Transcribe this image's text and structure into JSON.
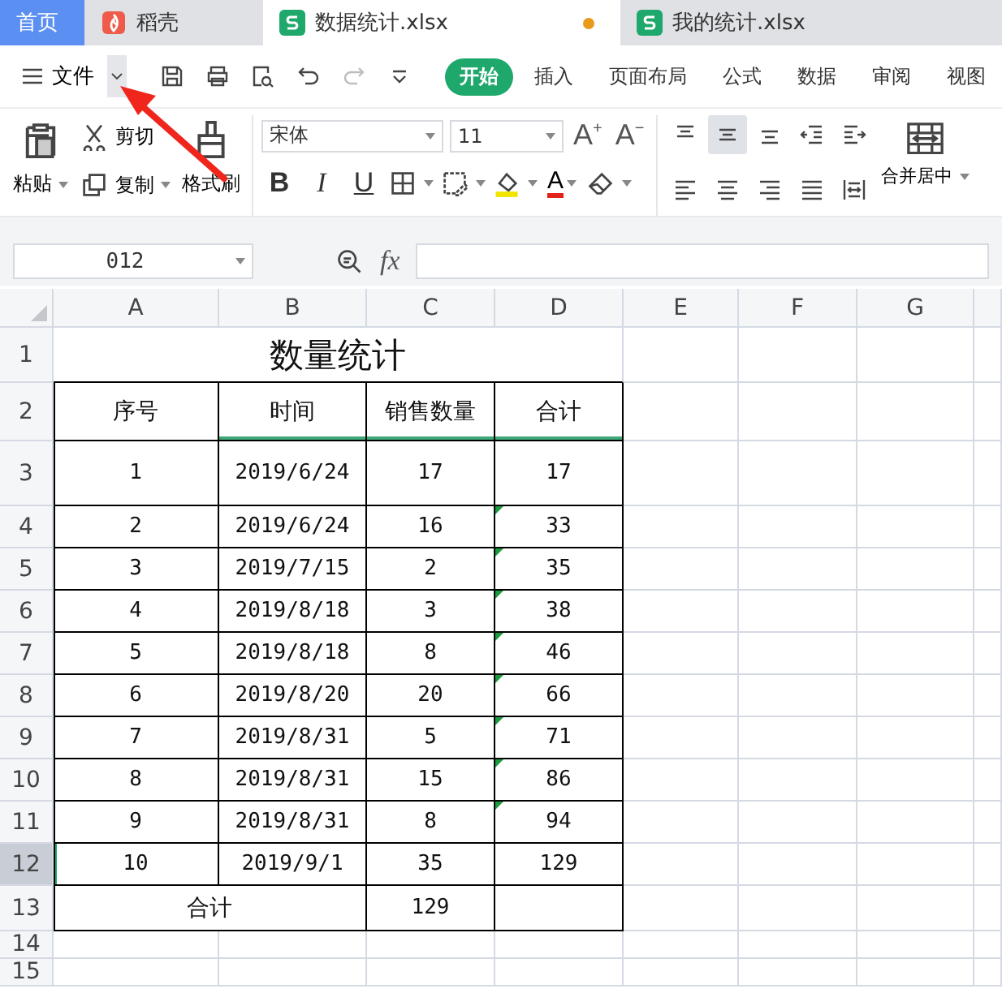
{
  "tabs": [
    {
      "label": "首页",
      "kind": "home",
      "selected": false,
      "modified": false
    },
    {
      "label": "稻壳",
      "kind": "docer",
      "selected": false,
      "modified": false
    },
    {
      "label": "数据统计.xlsx",
      "kind": "sheet",
      "selected": true,
      "modified": true
    },
    {
      "label": "我的统计.xlsx",
      "kind": "sheet",
      "selected": false,
      "modified": false
    }
  ],
  "menu": {
    "label": "文件"
  },
  "quick_tools": [
    {
      "kind": "save",
      "disabled": false
    },
    {
      "kind": "print",
      "disabled": false
    },
    {
      "kind": "preview",
      "disabled": false
    },
    {
      "kind": "undo",
      "disabled": false
    },
    {
      "kind": "redo",
      "disabled": true
    },
    {
      "kind": "more",
      "disabled": false
    }
  ],
  "ribbon_tabs": [
    {
      "label": "开始",
      "selected": true
    },
    {
      "label": "插入",
      "selected": false
    },
    {
      "label": "页面布局",
      "selected": false
    },
    {
      "label": "公式",
      "selected": false
    },
    {
      "label": "数据",
      "selected": false
    },
    {
      "label": "审阅",
      "selected": false
    },
    {
      "label": "视图",
      "selected": false
    }
  ],
  "clipboard": {
    "paste": "粘贴",
    "cut": "剪切",
    "copy": "复制",
    "painter": "格式刷"
  },
  "font": {
    "family": "宋体",
    "size": "11",
    "grow": "A",
    "grow_mark": "+",
    "shrink": "A",
    "shrink_mark": "−",
    "color_label": "A"
  },
  "format_buttons": [
    {
      "kind": "bold",
      "label": "B"
    },
    {
      "kind": "italic",
      "label": "I"
    },
    {
      "kind": "underline",
      "label": "U"
    }
  ],
  "align_buttons": [
    {
      "kind": "top",
      "selected": false
    },
    {
      "kind": "middle",
      "selected": true
    },
    {
      "kind": "bottom",
      "selected": false
    },
    {
      "kind": "outdent",
      "selected": false
    },
    {
      "kind": "indent",
      "selected": false
    },
    {
      "kind": "left",
      "selected": false
    },
    {
      "kind": "center",
      "selected": false
    },
    {
      "kind": "right",
      "selected": false
    },
    {
      "kind": "justify",
      "selected": false
    },
    {
      "kind": "distribute",
      "selected": false
    }
  ],
  "merge": {
    "label": "合并居中"
  },
  "formula_bar": {
    "cell": "012",
    "formula_icon": "fx"
  },
  "sheet": {
    "columns": [
      "A",
      "B",
      "C",
      "D",
      "E",
      "F",
      "G"
    ],
    "rows": [
      {
        "label": "1",
        "kind": "title",
        "selected": false,
        "freeze_below": false,
        "cells": [
          "",
          "数量统计",
          "",
          ""
        ]
      },
      {
        "label": "2",
        "kind": "header",
        "selected": false,
        "freeze_below": true,
        "cells": [
          "序号",
          "时间",
          "销售数量",
          "合计"
        ]
      },
      {
        "label": "3",
        "kind": "data",
        "selected": false,
        "text_number": false,
        "cells": [
          "1",
          "2019/6/24",
          "17",
          "17"
        ]
      },
      {
        "label": "4",
        "kind": "data",
        "selected": false,
        "text_number": true,
        "cells": [
          "2",
          "2019/6/24",
          "16",
          "33"
        ]
      },
      {
        "label": "5",
        "kind": "data",
        "selected": false,
        "text_number": true,
        "cells": [
          "3",
          "2019/7/15",
          "2",
          "35"
        ]
      },
      {
        "label": "6",
        "kind": "data",
        "selected": false,
        "text_number": true,
        "cells": [
          "4",
          "2019/8/18",
          "3",
          "38"
        ]
      },
      {
        "label": "7",
        "kind": "data",
        "selected": false,
        "text_number": true,
        "cells": [
          "5",
          "2019/8/18",
          "8",
          "46"
        ]
      },
      {
        "label": "8",
        "kind": "data",
        "selected": false,
        "text_number": true,
        "cells": [
          "6",
          "2019/8/20",
          "20",
          "66"
        ]
      },
      {
        "label": "9",
        "kind": "data",
        "selected": false,
        "text_number": true,
        "cells": [
          "7",
          "2019/8/31",
          "5",
          "71"
        ]
      },
      {
        "label": "10",
        "kind": "data",
        "selected": false,
        "text_number": true,
        "cells": [
          "8",
          "2019/8/31",
          "15",
          "86"
        ]
      },
      {
        "label": "11",
        "kind": "data",
        "selected": false,
        "text_number": true,
        "cells": [
          "9",
          "2019/8/31",
          "8",
          "94"
        ]
      },
      {
        "label": "12",
        "kind": "data",
        "selected": true,
        "text_number": false,
        "cells": [
          "10",
          "2019/9/1",
          "35",
          "129"
        ]
      },
      {
        "label": "13",
        "kind": "total",
        "selected": false,
        "cells": [
          "合计",
          "",
          "129",
          ""
        ]
      },
      {
        "label": "14",
        "kind": "empty",
        "selected": false,
        "cells": []
      },
      {
        "label": "15",
        "kind": "empty",
        "selected": false,
        "cells": []
      }
    ]
  },
  "annotation": {
    "kind": "arrow",
    "color": "#f0261c"
  }
}
